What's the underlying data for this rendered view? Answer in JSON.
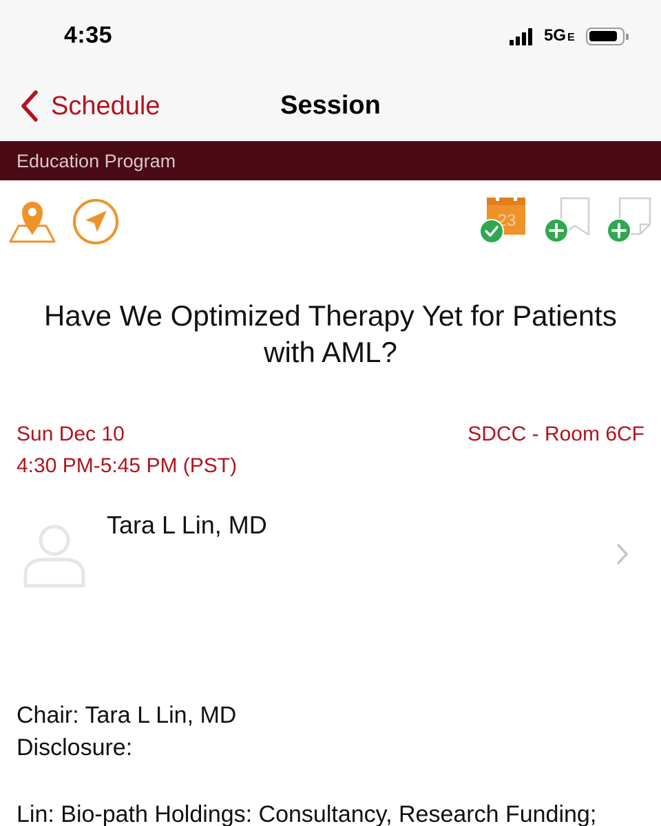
{
  "status_bar": {
    "time": "4:35",
    "network": "5G",
    "network_suffix": "E"
  },
  "nav": {
    "back_label": "Schedule",
    "title": "Session"
  },
  "program_label": "Education Program",
  "icons": {
    "map_pin": "map-pin-icon",
    "navigate": "navigate-arrow-icon",
    "calendar": "calendar-added-icon",
    "calendar_day": "23",
    "bookmark": "bookmark-add-icon",
    "note": "note-add-icon",
    "accent_color": "#f0922a",
    "check_color": "#2fa84f"
  },
  "session": {
    "title": "Have We Optimized Therapy Yet for Patients with AML?",
    "date": "Sun Dec 10",
    "time": "4:30 PM-5:45 PM (PST)",
    "room": "SDCC - Room 6CF"
  },
  "speaker": {
    "name": "Tara L Lin, MD"
  },
  "details": {
    "chair": "Chair: Tara L Lin, MD",
    "disclosure_label": "Disclosure:",
    "disclosure_text": "Lin: Bio-path Holdings: Consultancy, Research Funding;"
  },
  "colors": {
    "accent_red": "#b3121f",
    "program_bar": "#4a0a15"
  }
}
